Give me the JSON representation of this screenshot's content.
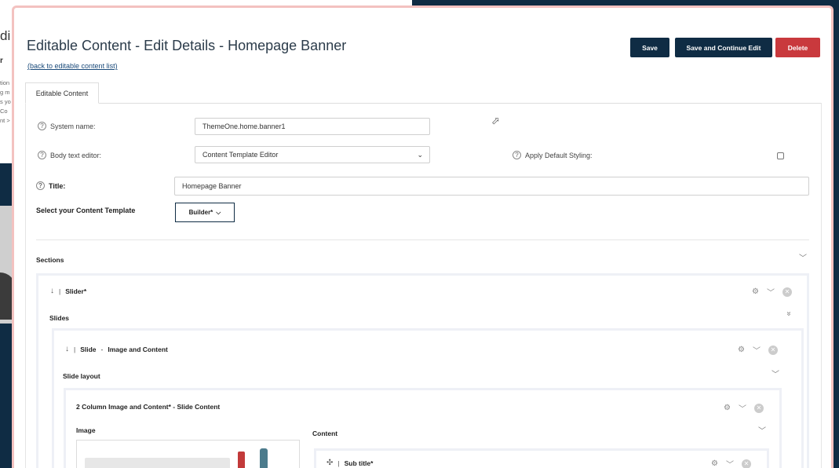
{
  "background_page": {
    "title_fragment": "di",
    "subtitle_fragment": "r",
    "text_fragments": [
      "tion",
      "g m",
      "s yo",
      "Co",
      "nt >"
    ]
  },
  "header": {
    "title": "Editable Content - Edit Details - Homepage Banner",
    "back_link": "(back to editable content list)",
    "buttons": {
      "save": "Save",
      "save_continue": "Save and Continue Edit",
      "delete": "Delete"
    }
  },
  "tabs": [
    {
      "label": "Editable Content",
      "active": true
    }
  ],
  "form": {
    "help_glyph": "?",
    "system_name": {
      "label": "System name:",
      "value": "ThemeOne.home.banner1"
    },
    "body_text_editor": {
      "label": "Body text editor:",
      "value": "Content Template Editor"
    },
    "apply_default_styling": {
      "label": "Apply Default Styling:",
      "checked": false
    },
    "title": {
      "label": "Title:",
      "value": "Homepage Banner"
    },
    "content_template": {
      "label": "Select your Content Template",
      "button": "Builder*"
    }
  },
  "sections": {
    "label": "Sections",
    "slider": {
      "arrow": "↓",
      "sep": "|",
      "name": "Slider*",
      "slides_label": "Slides",
      "slide": {
        "name": "Slide",
        "dash": "-",
        "type": "Image and Content",
        "layout_label": "Slide layout",
        "layout": {
          "title": "2 Column Image and Content* - Slide Content",
          "image_label": "Image",
          "content_label": "Content",
          "subtitle": {
            "move_glyph": "✣",
            "name": "Sub title*"
          }
        }
      }
    }
  },
  "icons": {
    "gear": "⚙",
    "chevron_down": "﹀",
    "double_chevron": "»",
    "close": "✕",
    "cursor": "⬀"
  },
  "colors": {
    "navy": "#0f2c44",
    "delete_red": "#c9393d",
    "window_border": "#f3c2c0"
  }
}
